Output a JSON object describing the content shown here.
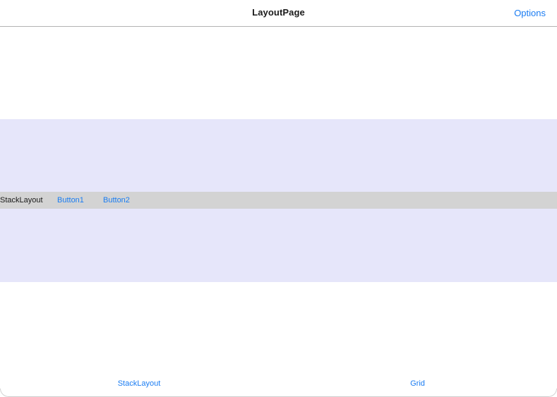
{
  "navbar": {
    "title": "LayoutPage",
    "options_label": "Options"
  },
  "stack": {
    "label": "StackLayout",
    "button1_label": "Button1",
    "button2_label": "Button2"
  },
  "tabs": [
    {
      "label": "StackLayout"
    },
    {
      "label": "Grid"
    }
  ],
  "colors": {
    "accent": "#1a7cf2",
    "lavender": "#e6e6fa",
    "row_gray": "#d3d3d3",
    "nav_border": "#b3b3b3"
  }
}
